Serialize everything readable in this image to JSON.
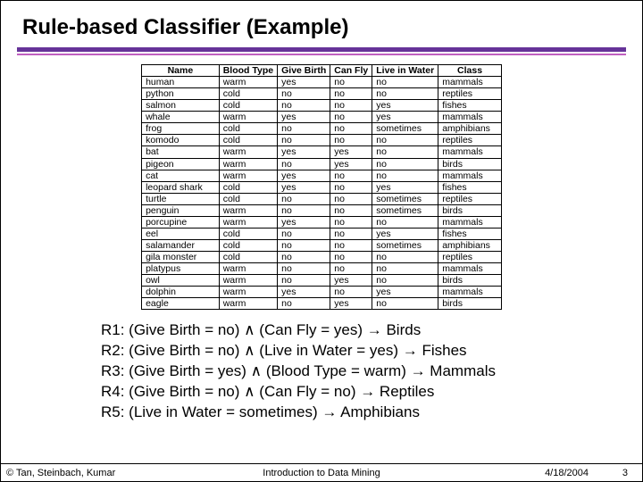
{
  "title": "Rule-based Classifier (Example)",
  "columns": [
    "Name",
    "Blood Type",
    "Give Birth",
    "Can Fly",
    "Live in Water",
    "Class"
  ],
  "rows": [
    [
      "human",
      "warm",
      "yes",
      "no",
      "no",
      "mammals"
    ],
    [
      "python",
      "cold",
      "no",
      "no",
      "no",
      "reptiles"
    ],
    [
      "salmon",
      "cold",
      "no",
      "no",
      "yes",
      "fishes"
    ],
    [
      "whale",
      "warm",
      "yes",
      "no",
      "yes",
      "mammals"
    ],
    [
      "frog",
      "cold",
      "no",
      "no",
      "sometimes",
      "amphibians"
    ],
    [
      "komodo",
      "cold",
      "no",
      "no",
      "no",
      "reptiles"
    ],
    [
      "bat",
      "warm",
      "yes",
      "yes",
      "no",
      "mammals"
    ],
    [
      "pigeon",
      "warm",
      "no",
      "yes",
      "no",
      "birds"
    ],
    [
      "cat",
      "warm",
      "yes",
      "no",
      "no",
      "mammals"
    ],
    [
      "leopard shark",
      "cold",
      "yes",
      "no",
      "yes",
      "fishes"
    ],
    [
      "turtle",
      "cold",
      "no",
      "no",
      "sometimes",
      "reptiles"
    ],
    [
      "penguin",
      "warm",
      "no",
      "no",
      "sometimes",
      "birds"
    ],
    [
      "porcupine",
      "warm",
      "yes",
      "no",
      "no",
      "mammals"
    ],
    [
      "eel",
      "cold",
      "no",
      "no",
      "yes",
      "fishes"
    ],
    [
      "salamander",
      "cold",
      "no",
      "no",
      "sometimes",
      "amphibians"
    ],
    [
      "gila monster",
      "cold",
      "no",
      "no",
      "no",
      "reptiles"
    ],
    [
      "platypus",
      "warm",
      "no",
      "no",
      "no",
      "mammals"
    ],
    [
      "owl",
      "warm",
      "no",
      "yes",
      "no",
      "birds"
    ],
    [
      "dolphin",
      "warm",
      "yes",
      "no",
      "yes",
      "mammals"
    ],
    [
      "eagle",
      "warm",
      "no",
      "yes",
      "no",
      "birds"
    ]
  ],
  "rules": [
    "R1: (Give Birth = no) ∧ (Can Fly = yes) → Birds",
    "R2: (Give Birth = no) ∧ (Live in Water = yes) → Fishes",
    "R3: (Give Birth = yes) ∧ (Blood Type = warm) → Mammals",
    "R4: (Give Birth = no) ∧ (Can Fly = no) → Reptiles",
    "R5: (Live in Water = sometimes) → Amphibians"
  ],
  "footer": {
    "left": "© Tan, Steinbach, Kumar",
    "center": "Introduction to Data Mining",
    "date": "4/18/2004",
    "page": "3"
  }
}
